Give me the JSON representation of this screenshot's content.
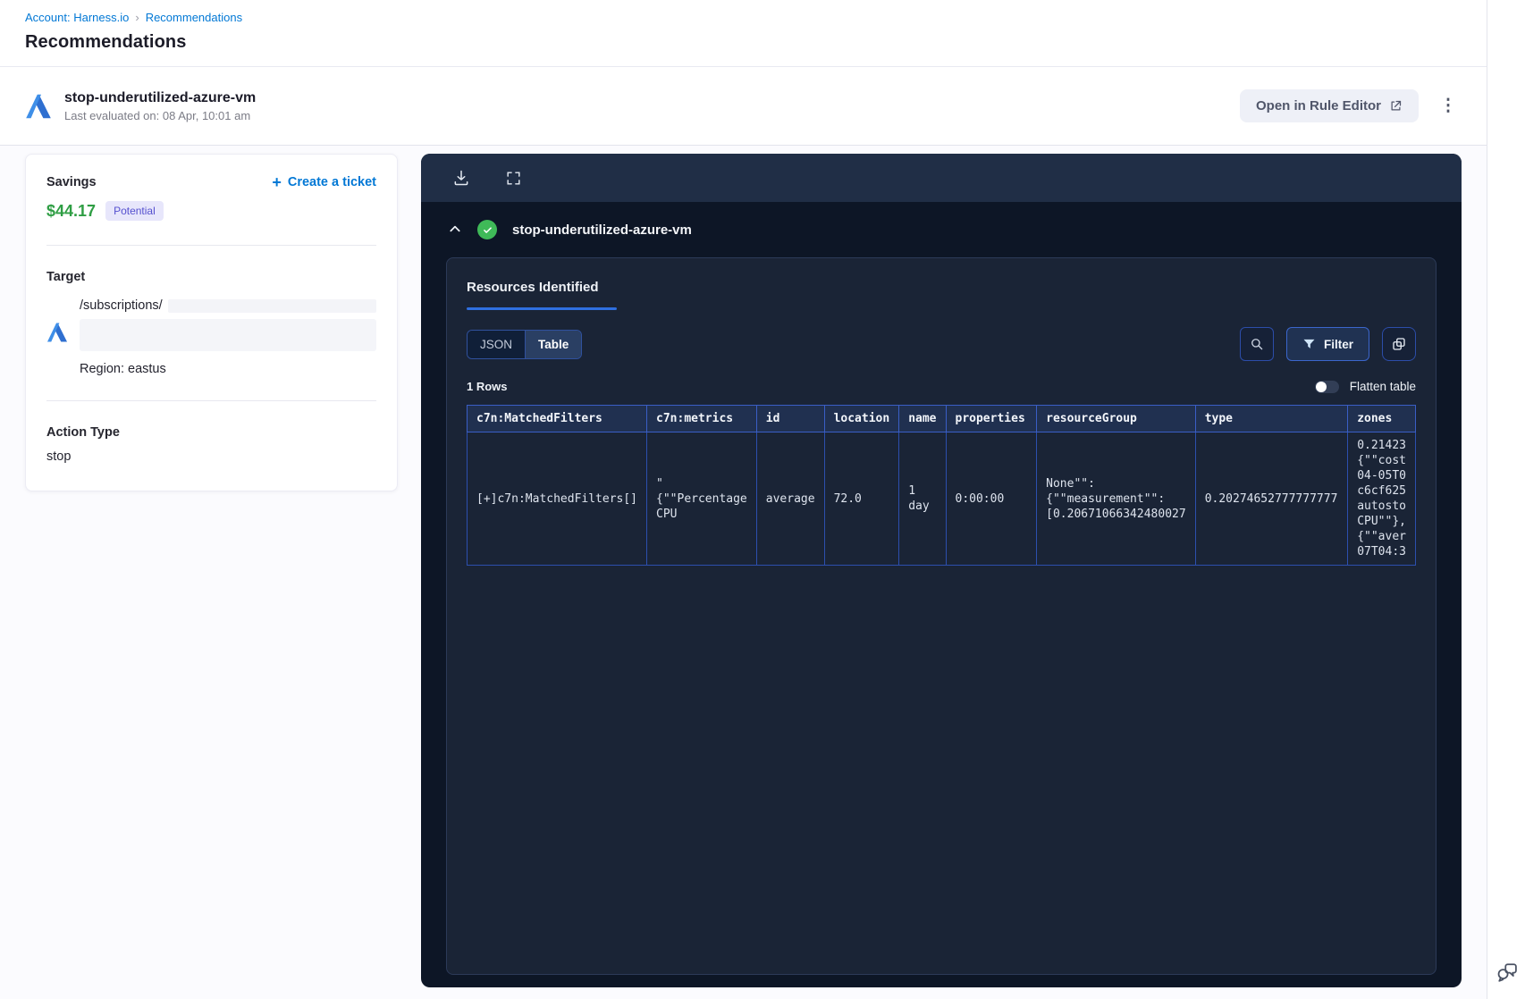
{
  "breadcrumb": {
    "account": "Account: Harness.io",
    "current": "Recommendations"
  },
  "page": {
    "title": "Recommendations"
  },
  "header": {
    "rule_name": "stop-underutilized-azure-vm",
    "last_evaluated": "Last evaluated on: 08 Apr, 10:01 am",
    "open_rule_editor_label": "Open in Rule Editor"
  },
  "details_card": {
    "savings_label": "Savings",
    "savings_amount": "$44.17",
    "savings_badge": "Potential",
    "create_ticket": {
      "plus": "+",
      "label": "Create a ticket"
    },
    "target_label": "Target",
    "target_path": "/subscriptions/",
    "region": "Region: eastus",
    "action_type_label": "Action Type",
    "action_type_value": "stop"
  },
  "panel": {
    "rule_name": "stop-underutilized-azure-vm",
    "tab_label": "Resources Identified",
    "view_toggle": {
      "json": "JSON",
      "table": "Table",
      "active": "Table"
    },
    "filter_label": "Filter",
    "rows_count": "1 Rows",
    "flatten_label": "Flatten table",
    "table": {
      "columns": [
        "c7n:MatchedFilters",
        "c7n:metrics",
        "id",
        "location",
        "name",
        "properties",
        "resourceGroup",
        "type",
        "zones"
      ],
      "row_cells": [
        "[+]c7n:MatchedFilters[]",
        "\"\n{\"\"Percentage\nCPU",
        "average",
        "72.0",
        "1\nday",
        "0:00:00",
        "None\"\":\n{\"\"measurement\"\":\n[0.20671066342480027",
        "0.20274652777777777",
        "0.21423\n{\"\"cost\n04-05T0\nc6cf625\nautosto\nCPU\"\"},\n{\"\"aver\n07T04:3"
      ]
    }
  },
  "colors": {
    "brand_blue": "#0278d5",
    "savings_green": "#2f9e44",
    "badge_purple": "#5550cf",
    "panel_bg": "#0d1626",
    "tab_accent_blue": "#2f6fe0",
    "table_border_blue": "#2c4fae",
    "matched_filters_teal": "#7cc2da",
    "check_green": "#3fba58"
  }
}
